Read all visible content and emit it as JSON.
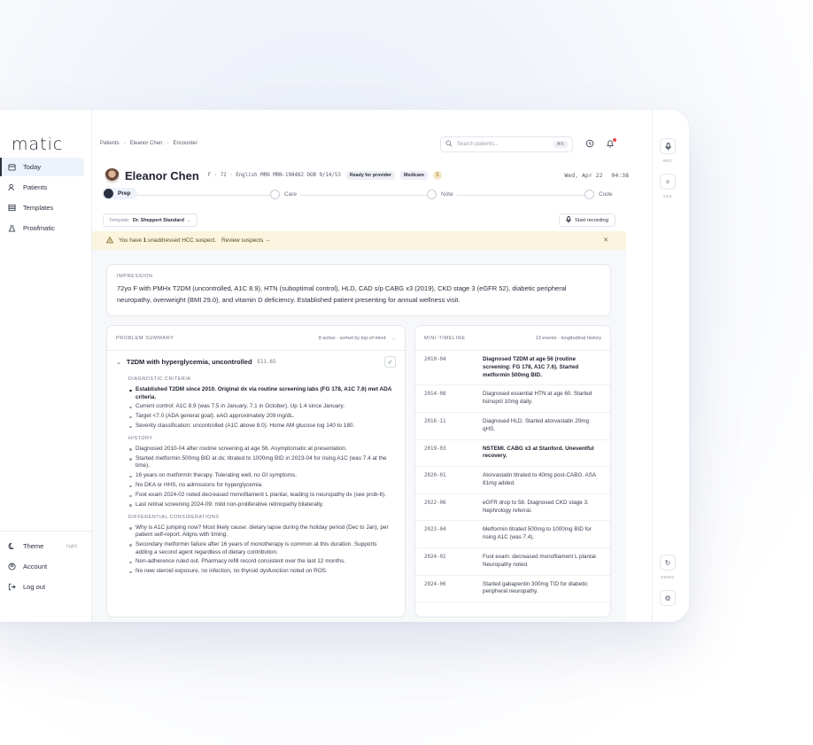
{
  "app": {
    "logo": "matic"
  },
  "sidebar": {
    "items": [
      {
        "label": "Today",
        "icon": "calendar-icon",
        "active": true
      },
      {
        "label": "Patients",
        "icon": "users-icon"
      },
      {
        "label": "Templates",
        "icon": "template-icon"
      },
      {
        "label": "Proofmatic",
        "icon": "flask-icon"
      }
    ],
    "bottom": [
      {
        "label": "Theme",
        "icon": "moon-icon",
        "value": "Light"
      },
      {
        "label": "Account",
        "icon": "account-icon"
      },
      {
        "label": "Log out",
        "icon": "logout-icon"
      }
    ]
  },
  "breadcrumb": [
    "Patients",
    "Eleanor Chen",
    "Encounter"
  ],
  "search": {
    "placeholder": "Search patients...",
    "shortcut": "⌘K"
  },
  "patient": {
    "name": "Eleanor Chen",
    "meta": "F · 72 · English  MRN MRN-198482  DOB 9/14/53",
    "badge_ready": "Ready for provider",
    "badge_payer": "Medicare",
    "coin": "$",
    "date": "Wed, Apr 22",
    "time": "04:38"
  },
  "steps": [
    "Prep",
    "Care",
    "Note",
    "Code"
  ],
  "template": {
    "prefix": "Template:",
    "name": "Dr. Sheppert Standard"
  },
  "record_button": "Start recording",
  "alert": {
    "text_pre": "You have ",
    "count": "1",
    "text_post": " unaddressed HCC suspect.",
    "link": "Review suspects →"
  },
  "impression": {
    "label": "IMPRESSION",
    "text": "72yo F with PMHx T2DM (uncontrolled, A1C 8.9), HTN (suboptimal control), HLD, CAD s/p CABG x3 (2019), CKD stage 3 (eGFR 52), diabetic peripheral neuropathy, overweight (BMI 29.0), and vitamin D deficiency. Established patient presenting for annual wellness visit."
  },
  "problems": {
    "label": "PROBLEM SUMMARY",
    "summary": "8 active · sorted by top-of-mind",
    "arrow": "→",
    "title": "T2DM with hyperglycemia, uncontrolled",
    "code": "E11.65",
    "sections": [
      {
        "label": "DIAGNOSTIC CRITERIA",
        "items": [
          {
            "text": "Established T2DM since 2010. Original dx via routine screening labs (FG 178, A1C 7.6) met ADA criteria.",
            "strong": true
          },
          {
            "text": "Current control: A1C 8.9 (was 7.5 in January, 7.1 in October). Up 1.4 since January."
          },
          {
            "text": "Target <7.0 (ADA general goal). eAG approximately 209 mg/dL."
          },
          {
            "text": "Severity classification: uncontrolled (A1C above 8.0). Home AM glucose log 140 to 180."
          }
        ]
      },
      {
        "label": "HISTORY",
        "items": [
          {
            "text": "Diagnosed 2010-04 after routine screening at age 56. Asymptomatic at presentation."
          },
          {
            "text": "Started metformin 500mg BID at dx; titrated to 1000mg BID in 2023-04 for rising A1C (was 7.4 at the time)."
          },
          {
            "text": "16 years on metformin therapy. Tolerating well, no GI symptoms."
          },
          {
            "text": "No DKA or HHS, no admissions for hyperglycemia."
          },
          {
            "text": "Foot exam 2024-02 noted decreased monofilament L plantar, leading to neuropathy dx (see prob-6)."
          },
          {
            "text": "Last retinal screening 2024-09: mild non-proliferative retinopathy bilaterally."
          }
        ]
      },
      {
        "label": "DIFFERENTIAL CONSIDERATIONS",
        "items": [
          {
            "text": "Why is A1C jumping now? Most likely cause: dietary lapse during the holiday period (Dec to Jan), per patient self-report. Aligns with timing."
          },
          {
            "text": "Secondary metformin failure after 16 years of monotherapy is common at this duration. Supports adding a second agent regardless of dietary contribution."
          },
          {
            "text": "Non-adherence ruled out. Pharmacy refill record consistent over the last 12 months."
          },
          {
            "text": "No new steroid exposure, no infection, no thyroid dysfunction noted on ROS."
          }
        ]
      }
    ]
  },
  "timeline": {
    "label": "MINI-TIMELINE",
    "summary": "13 events · longitudinal history",
    "events": [
      {
        "date": "2010-04",
        "text": "Diagnosed T2DM at age 56 (routine screening: FG 178, A1C 7.6). Started metformin 500mg BID.",
        "strong": true
      },
      {
        "date": "2014-08",
        "text": "Diagnosed essential HTN at age 60. Started lisinopril 10mg daily."
      },
      {
        "date": "2016-11",
        "text": "Diagnosed HLD. Started atorvastatin 20mg qHS."
      },
      {
        "date": "2019-03",
        "text": "NSTEMI. CABG x3 at Stanford. Uneventful recovery.",
        "strong": true
      },
      {
        "date": "2020-01",
        "text": "Atorvastatin titrated to 40mg post-CABG. ASA 81mg added."
      },
      {
        "date": "2022-06",
        "text": "eGFR drop to 58. Diagnosed CKD stage 3. Nephrology referral."
      },
      {
        "date": "2023-04",
        "text": "Metformin titrated 500mg to 1000mg BID for rising A1C (was 7.4)."
      },
      {
        "date": "2024-02",
        "text": "Foot exam: decreased monofilament L plantar. Neuropathy noted."
      },
      {
        "date": "2024-06",
        "text": "Started gabapentin 300mg TID for diabetic peripheral neuropathy."
      }
    ]
  },
  "rail": {
    "rec_label": "REC",
    "ask_label": "ASK",
    "demo_label": "DEMO"
  },
  "colors": {
    "accent": "#2c3140",
    "alert_bg": "#fbf4de",
    "active_nav": "#eef2fb"
  }
}
